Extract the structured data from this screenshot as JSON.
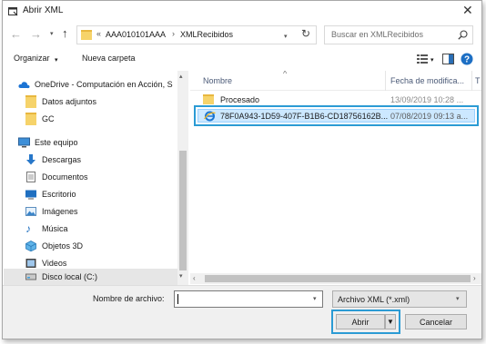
{
  "window": {
    "title": "Abrir XML"
  },
  "nav": {
    "back_icon": "back-arrow-icon",
    "forward_icon": "forward-arrow-icon",
    "up_icon": "up-arrow-icon",
    "overflow": "«",
    "path": [
      "AAA010101AAA",
      "XMLRecibidos"
    ],
    "separator": "›",
    "search_placeholder": "Buscar en XMLRecibidos"
  },
  "toolbar": {
    "organize_label": "Organizar",
    "new_folder_label": "Nueva carpeta"
  },
  "sidebar": {
    "items": [
      {
        "label": "OneDrive - Computación en Acción, S",
        "icon": "cloud-icon"
      },
      {
        "label": "Datos adjuntos",
        "icon": "folder-icon"
      },
      {
        "label": "GC",
        "icon": "folder-icon"
      },
      {
        "label": "Este equipo",
        "icon": "computer-icon"
      },
      {
        "label": "Descargas",
        "icon": "download-icon"
      },
      {
        "label": "Documentos",
        "icon": "documents-icon"
      },
      {
        "label": "Escritorio",
        "icon": "desktop-icon"
      },
      {
        "label": "Imágenes",
        "icon": "pictures-icon"
      },
      {
        "label": "Música",
        "icon": "music-icon"
      },
      {
        "label": "Objetos 3D",
        "icon": "cube-icon"
      },
      {
        "label": "Videos",
        "icon": "video-icon"
      },
      {
        "label": "Disco local (C:)",
        "icon": "drive-icon"
      }
    ]
  },
  "columns": {
    "name": "Nombre",
    "date": "Fecha de modifica...",
    "extra": "T"
  },
  "files": [
    {
      "name": "Procesado",
      "date": "13/09/2019 10:28 ...",
      "icon": "folder-icon"
    },
    {
      "name": "78F0A943-1D59-407F-B1B6-CD18756162B...",
      "date": "07/08/2019 09:13 a...",
      "icon": "xml-file-icon"
    }
  ],
  "footer": {
    "filename_label": "Nombre de archivo:",
    "filename_value": "",
    "filetype_value": "Archivo XML (*.xml)",
    "open_label": "Abrir",
    "cancel_label": "Cancelar"
  },
  "colors": {
    "accent": "#2b9bd4",
    "selection": "#cce8ff",
    "folder": "#f6d36a"
  }
}
